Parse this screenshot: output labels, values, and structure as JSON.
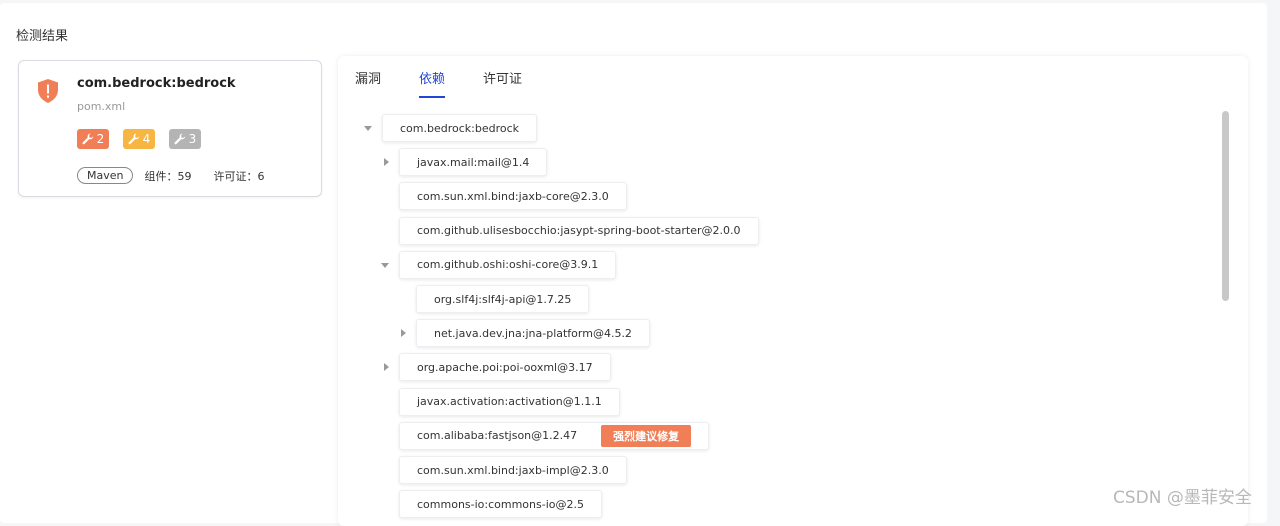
{
  "section_title": "检测结果",
  "project": {
    "name": "com.bedrock:bedrock",
    "file": "pom.xml",
    "issues": [
      {
        "count": "2",
        "color": "#f07e57"
      },
      {
        "count": "4",
        "color": "#f7b541"
      },
      {
        "count": "3",
        "color": "#b4b4b4"
      }
    ],
    "build_tool": "Maven",
    "components": "组件：59",
    "licenses": "许可证：6"
  },
  "tabs": [
    {
      "label": "漏洞"
    },
    {
      "label": "依赖"
    },
    {
      "label": "许可证"
    }
  ],
  "active_tab": "依赖",
  "tree": [
    {
      "label": "com.bedrock:bedrock",
      "depth": 0,
      "toggle": "expanded"
    },
    {
      "label": "javax.mail:mail@1.4",
      "depth": 1,
      "toggle": "collapsed"
    },
    {
      "label": "com.sun.xml.bind:jaxb-core@2.3.0",
      "depth": 1,
      "toggle": "none"
    },
    {
      "label": "com.github.ulisesbocchio:jasypt-spring-boot-starter@2.0.0",
      "depth": 1,
      "toggle": "none"
    },
    {
      "label": "com.github.oshi:oshi-core@3.9.1",
      "depth": 1,
      "toggle": "expanded"
    },
    {
      "label": "org.slf4j:slf4j-api@1.7.25",
      "depth": 2,
      "toggle": "none"
    },
    {
      "label": "net.java.dev.jna:jna-platform@4.5.2",
      "depth": 2,
      "toggle": "collapsed"
    },
    {
      "label": "org.apache.poi:poi-ooxml@3.17",
      "depth": 1,
      "toggle": "collapsed"
    },
    {
      "label": "javax.activation:activation@1.1.1",
      "depth": 1,
      "toggle": "none"
    },
    {
      "label": "com.alibaba:fastjson@1.2.47",
      "depth": 1,
      "toggle": "none",
      "tag": "强烈建议修复"
    },
    {
      "label": "com.sun.xml.bind:jaxb-impl@2.3.0",
      "depth": 1,
      "toggle": "none"
    },
    {
      "label": "commons-io:commons-io@2.5",
      "depth": 1,
      "toggle": "none"
    }
  ],
  "colors": {
    "accent": "#2346d6",
    "danger": "#f07e57",
    "warning": "#f7b541",
    "neutral": "#b4b4b4"
  },
  "watermark": "CSDN @墨菲安全"
}
